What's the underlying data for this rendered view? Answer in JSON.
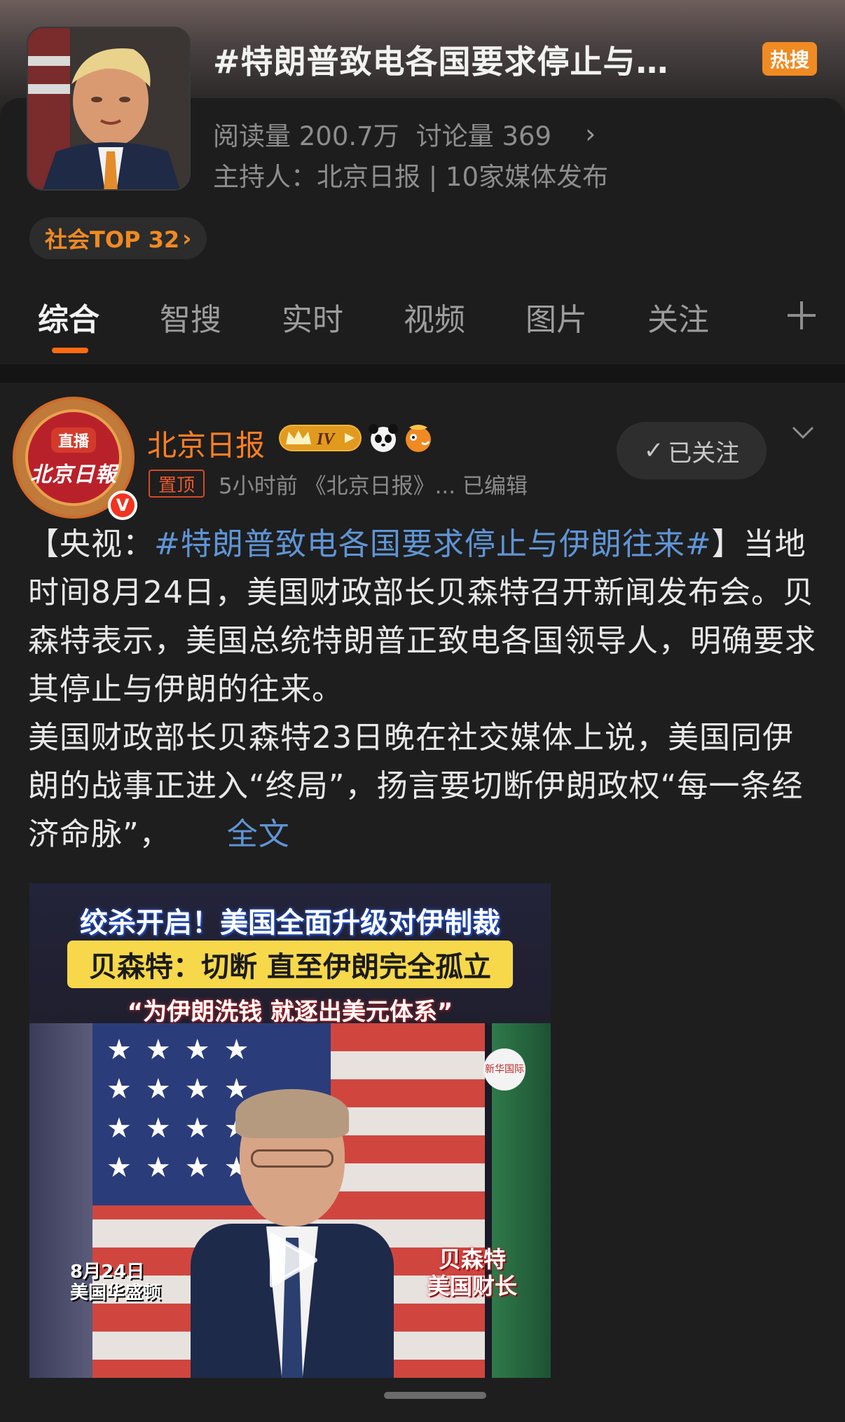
{
  "header": {
    "title": "#特朗普致电各国要求停止与…",
    "hot_badge": "热搜",
    "stats": {
      "reads": "阅读量 200.7万",
      "discussions": "讨论量 369"
    },
    "host": "主持人：北京日报 | 10家媒体发布",
    "rank": "社会TOP 32"
  },
  "tabs": [
    "综合",
    "智搜",
    "实时",
    "视频",
    "图片",
    "关注"
  ],
  "post": {
    "author": "北京日报",
    "avatar": {
      "live": "直播",
      "logo": "北京日報",
      "verified": "V"
    },
    "pinned_label": "置顶",
    "meta": "5小时前 《北京日报》... 已编辑",
    "follow_label": "已关注",
    "text": {
      "prefix": "【央视：",
      "hashtag": "#特朗普致电各国要求停止与伊朗往来#",
      "after_hashtag": "】当地时间8月24日，美国财政部长贝森特召开新闻发布会。贝森特表示，美国总统特朗普正致电各国领导人，明确要求其停止与伊朗的往来。",
      "para2": "美国财政部长贝森特23日晚在社交媒体上说，美国同伊朗的战事正进入“终局”，扬言要切断伊朗政权“每一条经济命脉”，",
      "more": "全文"
    },
    "video": {
      "line1": "绞杀开启！美国全面升级对伊制裁",
      "line2": "贝森特：切断 直至伊朗完全孤立",
      "line3": "“为伊朗洗钱 就逐出美元体系”",
      "caption_left_1": "8月24日",
      "caption_left_2": "美国华盛顿",
      "caption_right_1": "贝森特",
      "caption_right_2": "美国财长",
      "watermark": "新华国际"
    }
  },
  "colors": {
    "accent_orange": "#ff7f23",
    "link_blue": "#5f95d6",
    "hot_badge": "#f08a22",
    "tab_indicator": "#ff6a13"
  },
  "icons": [
    "chevron-right-icon",
    "plus-icon",
    "crown-badge-icon",
    "panda-icon",
    "fish-icon",
    "check-icon",
    "chevron-down-icon",
    "play-icon"
  ]
}
